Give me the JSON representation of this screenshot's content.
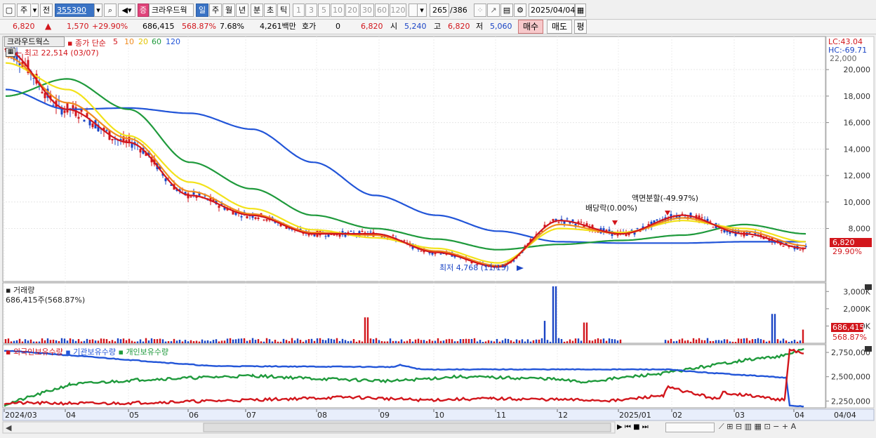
{
  "toolbar": {
    "market": "주",
    "prev": "전",
    "code": "355390",
    "badge": "증",
    "stock_name": "크라우드웍",
    "periods": [
      "일",
      "주",
      "월",
      "년",
      "분",
      "초",
      "틱"
    ],
    "active_period": "일",
    "ranges": [
      "1",
      "3",
      "5",
      "10",
      "20",
      "30",
      "60",
      "120"
    ],
    "count": "265",
    "count_total": "/386",
    "date": "2025/04/04"
  },
  "info": {
    "price": "6,820",
    "change": "1,570",
    "change_pct": "+29.90%",
    "volume": "686,415",
    "volume_ratio": "568.87%",
    "turnover": "7.68%",
    "trade_value": "4,261백만",
    "quote_label": "호가",
    "quote": "0",
    "quote_price": "6,820",
    "open_label": "시",
    "open": "5,240",
    "high_label": "고",
    "high": "6,820",
    "low_label": "저",
    "low": "5,060",
    "buy": "매수",
    "sell": "매도",
    "flat": "평"
  },
  "price_panel": {
    "stock_label": "크라우드웍스",
    "ma_title": "종가 단순",
    "ma_periods": [
      {
        "label": "5",
        "color": "#d2161c"
      },
      {
        "label": "10",
        "color": "#f08a1e"
      },
      {
        "label": "20",
        "color": "#f2e21a"
      },
      {
        "label": "60",
        "color": "#1f9a3c"
      },
      {
        "label": "120",
        "color": "#2255d8"
      }
    ],
    "high_note": "← 최고 22,514 (03/07)",
    "low_note": "최저 4,768 (11/15)",
    "event1": "배당락(0.00%)",
    "event2": "액면분할(-49.97%)",
    "lc": "LC:43.04",
    "hc": "HC:-69.71",
    "last_price_tag": "6,820",
    "last_pct_tag": "29.90%",
    "y_ticks": [
      "20,000",
      "18,000",
      "16,000",
      "14,000",
      "12,000",
      "10,000",
      "8,000"
    ],
    "y_top_partial": "22,000"
  },
  "volume_panel": {
    "title": "거래량",
    "value": "686,415주(568.87%)",
    "y_ticks": [
      "3,000K",
      "2,000K",
      "1,000K"
    ],
    "last_tag": "686,415",
    "last_pct": "568.87%"
  },
  "holdings_panel": {
    "series": [
      "외국인보유수량",
      "기관보유수량",
      "개인보유수량"
    ],
    "y_ticks": [
      "2,750,000",
      "2,500,000",
      "2,250,000"
    ]
  },
  "x_axis": [
    "2024/03",
    "04",
    "05",
    "06",
    "07",
    "08",
    "09",
    "10",
    "11",
    "12",
    "2025/01",
    "02",
    "03",
    "04",
    "04/04"
  ],
  "chart_data": {
    "type": "line",
    "title": "",
    "x": [
      "2024/03",
      "04",
      "05",
      "06",
      "07",
      "08",
      "09",
      "10",
      "11",
      "12",
      "2025/01",
      "02",
      "03",
      "04"
    ],
    "series": [
      {
        "name": "5",
        "color": "#d2161c",
        "values": [
          21500,
          17000,
          14500,
          10500,
          9000,
          7600,
          7600,
          6200,
          5100,
          8600,
          7600,
          9000,
          7600,
          6500
        ]
      },
      {
        "name": "10",
        "color": "#f08a1e",
        "values": [
          21000,
          17500,
          14800,
          10800,
          9100,
          7700,
          7500,
          6300,
          5200,
          8300,
          7600,
          8800,
          7800,
          6700
        ]
      },
      {
        "name": "20",
        "color": "#f2e21a",
        "values": [
          20500,
          18500,
          15000,
          11500,
          9500,
          7900,
          7300,
          6500,
          5400,
          8000,
          7700,
          8600,
          8000,
          7000
        ]
      },
      {
        "name": "60",
        "color": "#1f9a3c",
        "values": [
          18000,
          19300,
          17000,
          13000,
          11000,
          9000,
          8000,
          7200,
          6400,
          6800,
          7100,
          7500,
          8300,
          7600
        ]
      },
      {
        "name": "120",
        "color": "#2255d8",
        "values": [
          18500,
          17000,
          17100,
          16700,
          15500,
          13000,
          10500,
          9000,
          7800,
          7000,
          6900,
          6900,
          7000,
          7000
        ]
      }
    ],
    "ylabel": "",
    "ylim": [
      4000,
      22500
    ]
  }
}
